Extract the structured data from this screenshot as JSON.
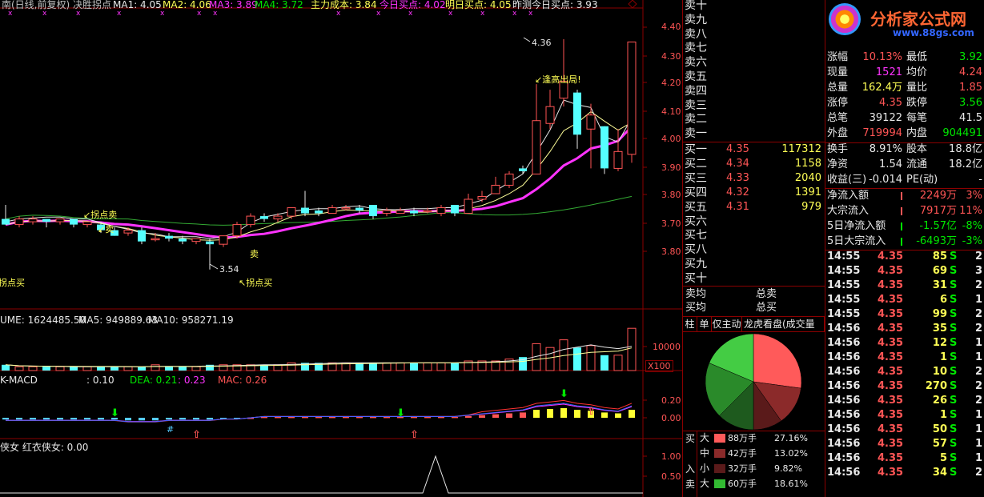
{
  "header": {
    "stock_title": "南(日线,前复权) 决胜拐点",
    "ma1": "MA1: 4.05",
    "ma2": "MA2: 4.06",
    "ma3": "MA3: 3.89",
    "ma4": "MA4: 3.72",
    "main_cost": "主力成本: 3.84",
    "today_buy": "今日买点: 4.02",
    "tomorrow_buy": "明日买点: 4.05",
    "yest_buy": "昨测今日买点: 3.93"
  },
  "colors": {
    "up": "#ff5555",
    "down": "#55ffff",
    "ma_mag": "#ff33ff",
    "ma_green": "#33aa33",
    "ma_yellow": "#ffff99",
    "ma_white": "#e8e8e8",
    "frame": "#8b0000",
    "accent_yellow": "#ffff55"
  },
  "price_axis": [
    "4.40",
    "4.30",
    "4.20",
    "4.10",
    "4.00",
    "3.90",
    "3.80",
    "3.70",
    "3.80"
  ],
  "annotations": {
    "high": "4.36",
    "low": "3.54",
    "top_msg": "逢高出局!",
    "turn_sell": "拐点卖",
    "sell": "卖",
    "sell2": "卖",
    "turn_buy": "拐点买",
    "turn_buy_left": "拐点买"
  },
  "volume": {
    "label": "UME: 1624485.50",
    "ma5": "MA5: 949889.63",
    "ma10": "MA10: 958271.19",
    "axis_10000": "10000",
    "axis_x100": "X100"
  },
  "macd": {
    "label": "K-MACD",
    "val": ": 0.10",
    "dea": "DEA: 0.21",
    "val2": ": 0.23",
    "mac": "MAC: 0.26",
    "axis_020": "0.20",
    "axis_000": "0.00"
  },
  "bottom": {
    "label": "侠女  红衣侠女: 0.00",
    "axis_100": "1.00",
    "axis_050": "0.50"
  },
  "orderbook": {
    "sells": [
      "卖十",
      "卖九",
      "卖八",
      "卖七",
      "卖六",
      "卖五",
      "卖四",
      "卖三",
      "卖二",
      "卖一"
    ],
    "buys": [
      {
        "label": "买一",
        "price": "4.35",
        "vol": "117312"
      },
      {
        "label": "买二",
        "price": "4.34",
        "vol": "1158"
      },
      {
        "label": "买三",
        "price": "4.33",
        "vol": "2040"
      },
      {
        "label": "买四",
        "price": "4.32",
        "vol": "1391"
      },
      {
        "label": "买五",
        "price": "4.31",
        "vol": "979"
      },
      {
        "label": "买六",
        "price": "",
        "vol": ""
      },
      {
        "label": "买七",
        "price": "",
        "vol": ""
      },
      {
        "label": "买八",
        "price": "",
        "vol": ""
      },
      {
        "label": "买九",
        "price": "",
        "vol": ""
      },
      {
        "label": "买十",
        "price": "",
        "vol": ""
      }
    ],
    "sell_avg": "卖均",
    "buy_avg": "买均",
    "total_sell": "总卖",
    "total_buy": "总买"
  },
  "tabs": [
    "柱",
    "单",
    "仅主动",
    "龙虎看盘(成交量按"
  ],
  "pie_legend": {
    "buy_label": "买",
    "in_label": "入",
    "sell_label": "卖",
    "rows": [
      {
        "size": "大",
        "vol": "88万手",
        "pct": "27.16%",
        "color": "#ff5a5a"
      },
      {
        "size": "中",
        "vol": "42万手",
        "pct": "13.02%",
        "color": "#8b2a2a"
      },
      {
        "size": "小",
        "vol": "32万手",
        "pct": "9.82%",
        "color": "#5a1a1a"
      },
      {
        "size": "大",
        "vol": "60万手",
        "pct": "18.61%",
        "color": "#33bb33"
      }
    ]
  },
  "pie_data": [
    {
      "value": 27.16,
      "color": "#ff5a5a"
    },
    {
      "value": 13.02,
      "color": "#8b2a2a"
    },
    {
      "value": 9.82,
      "color": "#5a1a1a"
    },
    {
      "value": 12.5,
      "color": "#1e5a1e"
    },
    {
      "value": 18.89,
      "color": "#2a8a2a"
    },
    {
      "value": 18.61,
      "color": "#44cc44"
    }
  ],
  "logo": {
    "title": "分析家公式网",
    "url": "www.88gs.com"
  },
  "stats": [
    {
      "k1": "涨幅",
      "v1": "10.13%",
      "c1": "red",
      "k2": "最低",
      "v2": "3.92",
      "c2": "grn"
    },
    {
      "k1": "现量",
      "v1": "1521",
      "c1": "mag",
      "k2": "均价",
      "v2": "4.24",
      "c2": "red"
    },
    {
      "k1": "总量",
      "v1": "162.4万",
      "c1": "yel",
      "k2": "量比",
      "v2": "1.85",
      "c2": "red"
    },
    {
      "k1": "涨停",
      "v1": "4.35",
      "c1": "red",
      "k2": "跌停",
      "v2": "3.56",
      "c2": "grn"
    },
    {
      "k1": "总笔",
      "v1": "39122",
      "c1": "wht",
      "k2": "每笔",
      "v2": "41.5",
      "c2": "wht"
    },
    {
      "k1": "外盘",
      "v1": "719994",
      "c1": "red",
      "k2": "内盘",
      "v2": "904491",
      "c2": "grn"
    }
  ],
  "stats2": [
    {
      "k1": "换手",
      "v1": "8.91%",
      "k2": "股本",
      "v2": "18.8亿"
    },
    {
      "k1": "净资",
      "v1": "1.54",
      "k2": "流通",
      "v2": "18.2亿"
    },
    {
      "k1": "收益(三)",
      "v1": "-0.014",
      "k2": "PE(动)",
      "v2": "-"
    }
  ],
  "flows": [
    {
      "k": "净流入额",
      "v": "2249万",
      "p": "3%",
      "c": "red"
    },
    {
      "k": "大宗流入",
      "v": "7917万",
      "p": "11%",
      "c": "red"
    },
    {
      "k": "5日净流入额",
      "v": "-1.57亿",
      "p": "-8%",
      "c": "grn"
    },
    {
      "k": "5日大宗流入",
      "v": "-6493万",
      "p": "-3%",
      "c": "grn"
    }
  ],
  "ticks": [
    {
      "t": "14:55",
      "p": "4.35",
      "v": "85",
      "s": "S",
      "n": "2"
    },
    {
      "t": "14:55",
      "p": "4.35",
      "v": "69",
      "s": "S",
      "n": "3"
    },
    {
      "t": "14:55",
      "p": "4.35",
      "v": "31",
      "s": "S",
      "n": "2"
    },
    {
      "t": "14:55",
      "p": "4.35",
      "v": "6",
      "s": "S",
      "n": "1"
    },
    {
      "t": "14:55",
      "p": "4.35",
      "v": "99",
      "s": "S",
      "n": "2"
    },
    {
      "t": "14:56",
      "p": "4.35",
      "v": "35",
      "s": "S",
      "n": "2"
    },
    {
      "t": "14:56",
      "p": "4.35",
      "v": "12",
      "s": "S",
      "n": "1"
    },
    {
      "t": "14:56",
      "p": "4.35",
      "v": "1",
      "s": "S",
      "n": "1"
    },
    {
      "t": "14:56",
      "p": "4.35",
      "v": "10",
      "s": "S",
      "n": "2"
    },
    {
      "t": "14:56",
      "p": "4.35",
      "v": "270",
      "s": "S",
      "n": "2"
    },
    {
      "t": "14:56",
      "p": "4.35",
      "v": "26",
      "s": "S",
      "n": "2"
    },
    {
      "t": "14:56",
      "p": "4.35",
      "v": "1",
      "s": "S",
      "n": "1"
    },
    {
      "t": "14:56",
      "p": "4.35",
      "v": "50",
      "s": "S",
      "n": "1"
    },
    {
      "t": "14:56",
      "p": "4.35",
      "v": "57",
      "s": "S",
      "n": "1"
    },
    {
      "t": "14:56",
      "p": "4.35",
      "v": "5",
      "s": "S",
      "n": "1"
    },
    {
      "t": "14:56",
      "p": "4.35",
      "v": "34",
      "s": "S",
      "n": "2"
    }
  ],
  "candles": [
    [
      3.72,
      3.7,
      3.77,
      3.7
    ],
    [
      3.7,
      3.72,
      3.73,
      3.69
    ],
    [
      3.71,
      3.72,
      3.73,
      3.7
    ],
    [
      3.72,
      3.71,
      3.72,
      3.69
    ],
    [
      3.71,
      3.72,
      3.72,
      3.7
    ],
    [
      3.72,
      3.7,
      3.72,
      3.69
    ],
    [
      3.7,
      3.71,
      3.71,
      3.69
    ],
    [
      3.7,
      3.68,
      3.71,
      3.67
    ],
    [
      3.68,
      3.66,
      3.69,
      3.66
    ],
    [
      3.67,
      3.68,
      3.69,
      3.66
    ],
    [
      3.68,
      3.64,
      3.69,
      3.63
    ],
    [
      3.65,
      3.65,
      3.67,
      3.64
    ],
    [
      3.66,
      3.65,
      3.67,
      3.64
    ],
    [
      3.65,
      3.64,
      3.66,
      3.63
    ],
    [
      3.64,
      3.65,
      3.65,
      3.63
    ],
    [
      3.64,
      3.63,
      3.65,
      3.54
    ],
    [
      3.63,
      3.66,
      3.66,
      3.62
    ],
    [
      3.66,
      3.7,
      3.71,
      3.65
    ],
    [
      3.7,
      3.73,
      3.74,
      3.69
    ],
    [
      3.73,
      3.72,
      3.74,
      3.71
    ],
    [
      3.72,
      3.73,
      3.74,
      3.71
    ],
    [
      3.73,
      3.76,
      3.76,
      3.72
    ],
    [
      3.76,
      3.74,
      3.82,
      3.73
    ],
    [
      3.75,
      3.74,
      3.76,
      3.73
    ],
    [
      3.74,
      3.76,
      3.77,
      3.74
    ],
    [
      3.76,
      3.76,
      3.77,
      3.75
    ],
    [
      3.76,
      3.75,
      3.77,
      3.74
    ],
    [
      3.77,
      3.73,
      3.77,
      3.72
    ],
    [
      3.74,
      3.75,
      3.76,
      3.73
    ],
    [
      3.74,
      3.75,
      3.76,
      3.74
    ],
    [
      3.75,
      3.74,
      3.76,
      3.73
    ],
    [
      3.75,
      3.75,
      3.76,
      3.74
    ],
    [
      3.74,
      3.76,
      3.77,
      3.73
    ],
    [
      3.77,
      3.74,
      3.77,
      3.73
    ],
    [
      3.74,
      3.79,
      3.81,
      3.74
    ],
    [
      3.79,
      3.8,
      3.82,
      3.78
    ],
    [
      3.81,
      3.84,
      3.87,
      3.81
    ],
    [
      3.84,
      3.88,
      3.89,
      3.83
    ],
    [
      3.9,
      3.89,
      3.91,
      3.88
    ],
    [
      3.88,
      4.07,
      4.2,
      3.88
    ],
    [
      4.06,
      4.12,
      4.18,
      4.04
    ],
    [
      4.15,
      4.21,
      4.36,
      4.12
    ],
    [
      4.17,
      4.02,
      4.18,
      3.97
    ],
    [
      4.04,
      4.09,
      4.13,
      3.9
    ],
    [
      4.05,
      3.9,
      4.05,
      3.88
    ],
    [
      3.9,
      3.96,
      4.04,
      3.89
    ],
    [
      3.95,
      4.35,
      4.35,
      3.92
    ]
  ],
  "volumes": [
    3,
    2,
    2,
    2,
    2,
    2,
    2,
    2,
    2,
    2,
    2,
    3,
    2,
    2,
    2,
    3,
    3,
    3,
    3,
    3,
    3,
    4,
    4,
    4,
    4,
    4,
    4,
    4,
    4,
    4,
    4,
    4,
    4,
    4,
    5,
    5,
    5,
    6,
    7,
    14,
    12,
    16,
    12,
    13,
    8,
    8,
    22
  ],
  "macd_bars": [
    -0.02,
    -0.02,
    -0.02,
    -0.02,
    -0.02,
    -0.02,
    -0.02,
    -0.02,
    -0.02,
    -0.03,
    -0.03,
    -0.03,
    -0.02,
    -0.02,
    -0.02,
    -0.02,
    -0.01,
    -0.01,
    0,
    0.01,
    0.01,
    0.01,
    0.01,
    0.01,
    0.01,
    0.01,
    0.01,
    0.01,
    0.01,
    0.01,
    0.01,
    0.01,
    0.01,
    0.01,
    0.02,
    0.03,
    0.04,
    0.05,
    0.06,
    0.09,
    0.1,
    0.11,
    0.09,
    0.08,
    0.06,
    0.05,
    0.09
  ]
}
